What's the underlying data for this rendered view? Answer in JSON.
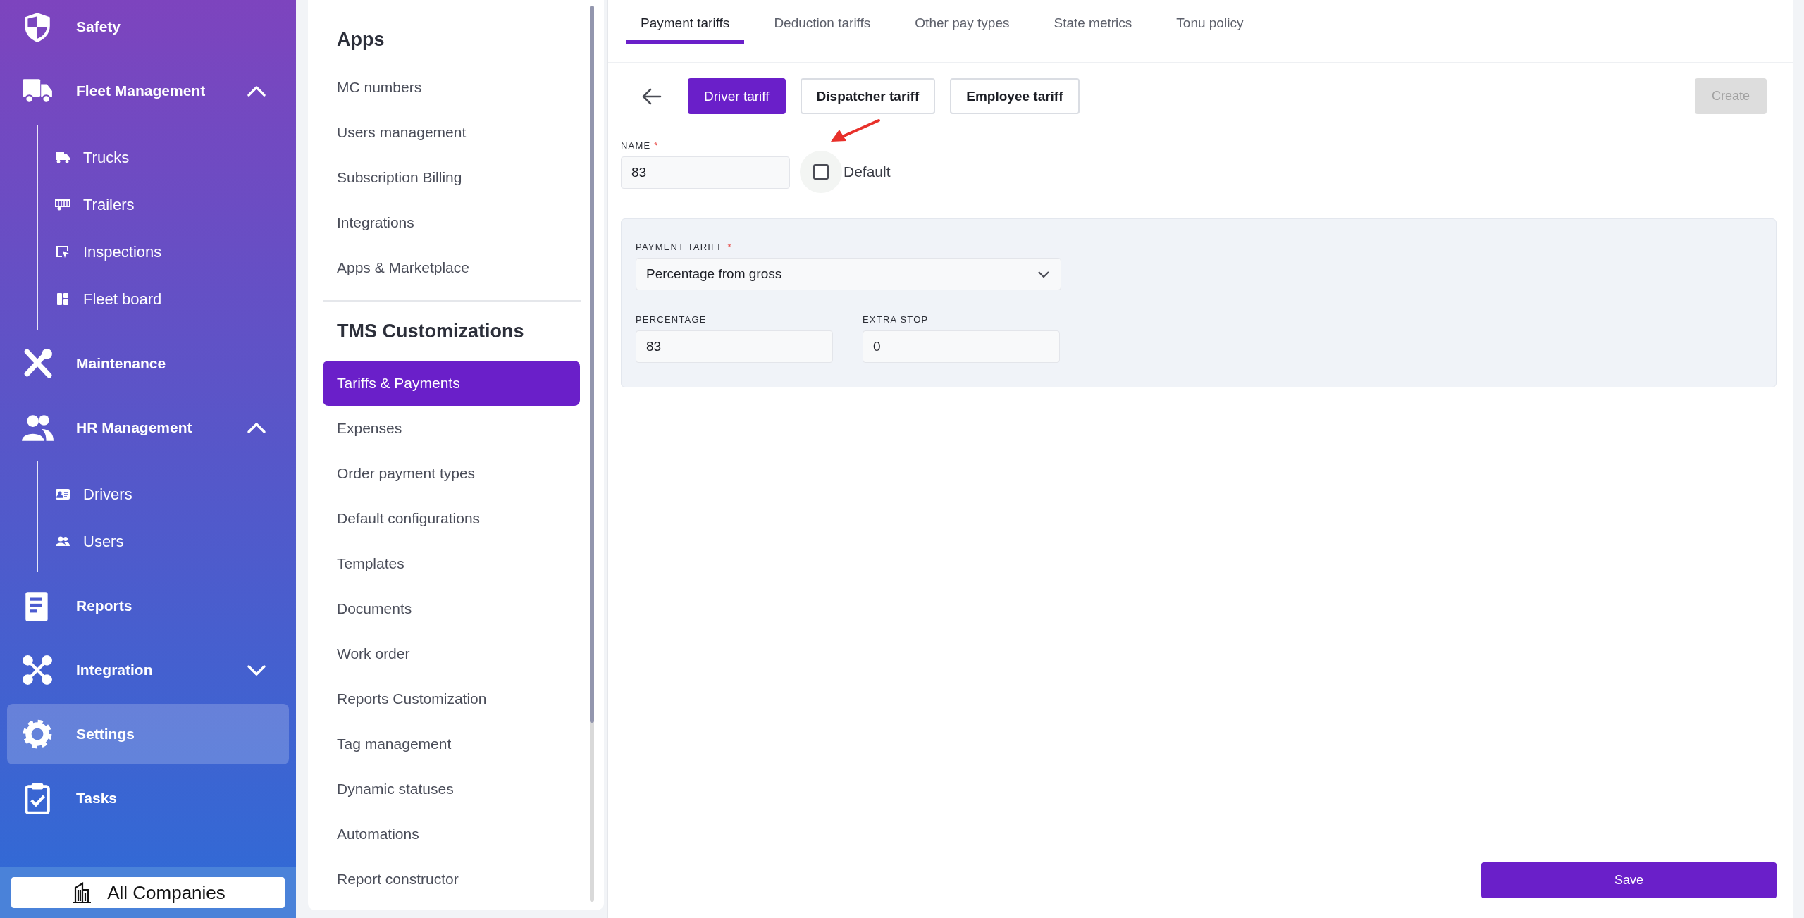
{
  "sidebar": {
    "items": [
      {
        "kind": "link",
        "label": "Safety",
        "selected": false
      },
      {
        "kind": "group",
        "label": "Fleet Management",
        "selected": false,
        "expanded": true,
        "children": [
          {
            "label": "Trucks",
            "selected": false
          },
          {
            "label": "Trailers",
            "selected": false
          },
          {
            "label": "Inspections",
            "selected": false
          },
          {
            "label": "Fleet board",
            "selected": false
          }
        ]
      },
      {
        "kind": "link",
        "label": "Maintenance",
        "selected": false
      },
      {
        "kind": "group",
        "label": "HR Management",
        "selected": false,
        "expanded": true,
        "children": [
          {
            "label": "Drivers",
            "selected": false
          },
          {
            "label": "Users",
            "selected": false
          }
        ]
      },
      {
        "kind": "link",
        "label": "Reports",
        "selected": false
      },
      {
        "kind": "group",
        "label": "Integration",
        "selected": false,
        "expanded": false
      },
      {
        "kind": "link",
        "label": "Settings",
        "selected": true
      },
      {
        "kind": "link",
        "label": "Tasks",
        "selected": false
      }
    ],
    "company_button": "All Companies"
  },
  "settings_menu": {
    "sections": [
      {
        "title": "Apps",
        "items": [
          {
            "label": "MC numbers",
            "selected": false
          },
          {
            "label": "Users management",
            "selected": false
          },
          {
            "label": "Subscription Billing",
            "selected": false
          },
          {
            "label": "Integrations",
            "selected": false
          },
          {
            "label": "Apps & Marketplace",
            "selected": false
          }
        ]
      },
      {
        "title": "TMS Customizations",
        "items": [
          {
            "label": "Tariffs & Payments",
            "selected": true
          },
          {
            "label": "Expenses",
            "selected": false
          },
          {
            "label": "Order payment types",
            "selected": false
          },
          {
            "label": "Default configurations",
            "selected": false
          },
          {
            "label": "Templates",
            "selected": false
          },
          {
            "label": "Documents",
            "selected": false
          },
          {
            "label": "Work order",
            "selected": false
          },
          {
            "label": "Reports Customization",
            "selected": false
          },
          {
            "label": "Tag management",
            "selected": false
          },
          {
            "label": "Dynamic statuses",
            "selected": false
          },
          {
            "label": "Automations",
            "selected": false
          },
          {
            "label": "Report constructor",
            "selected": false
          }
        ]
      }
    ]
  },
  "tabs": [
    {
      "label": "Payment tariffs",
      "selected": true
    },
    {
      "label": "Deduction tariffs",
      "selected": false
    },
    {
      "label": "Other pay types",
      "selected": false
    },
    {
      "label": "State metrics",
      "selected": false
    },
    {
      "label": "Tonu policy",
      "selected": false
    }
  ],
  "tariff_types": [
    {
      "label": "Driver tariff",
      "selected": true
    },
    {
      "label": "Dispatcher tariff",
      "selected": false
    },
    {
      "label": "Employee tariff",
      "selected": false
    }
  ],
  "create_button": {
    "label": "Create",
    "disabled": true
  },
  "name_field": {
    "label": "NAME",
    "required_mark": "*",
    "value": "83"
  },
  "default_checkbox": {
    "label": "Default",
    "checked": false
  },
  "tariff_panel": {
    "payment_tariff": {
      "label": "PAYMENT TARIFF",
      "required_mark": "*",
      "value": "Percentage from gross"
    },
    "percentage": {
      "label": "PERCENTAGE",
      "value": "83"
    },
    "extra_stop": {
      "label": "EXTRA STOP",
      "value": "0"
    }
  },
  "save_button": "Save"
}
